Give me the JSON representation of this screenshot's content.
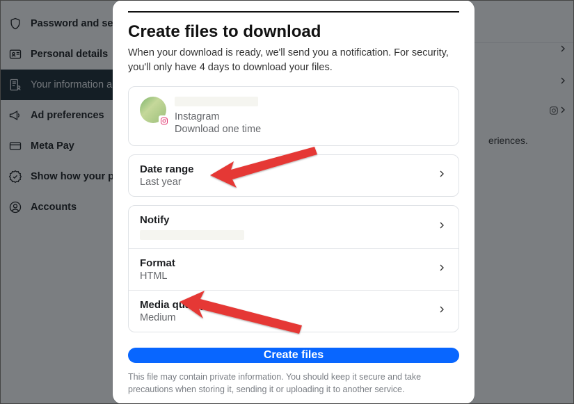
{
  "sidebar": {
    "items": [
      {
        "label": "Password and security"
      },
      {
        "label": "Personal details"
      },
      {
        "label": "Your information and permissions"
      },
      {
        "label": "Ad preferences"
      },
      {
        "label": "Meta Pay"
      },
      {
        "label": "Show how your profile is verified"
      },
      {
        "label": "Accounts"
      }
    ]
  },
  "background": {
    "text_fragment": "eriences."
  },
  "modal": {
    "title": "Create files to download",
    "subtitle": "When your download is ready, we'll send you a notification. For security, you'll only have 4 days to download your files.",
    "profile": {
      "platform": "Instagram",
      "frequency": "Download one time"
    },
    "options": {
      "date_range": {
        "label": "Date range",
        "value": "Last year"
      },
      "notify": {
        "label": "Notify"
      },
      "format": {
        "label": "Format",
        "value": "HTML"
      },
      "media": {
        "label": "Media quality",
        "value": "Medium"
      }
    },
    "create_button": "Create files",
    "footer": "This file may contain private information. You should keep it secure and take precautions when storing it, sending it or uploading it to another service."
  }
}
